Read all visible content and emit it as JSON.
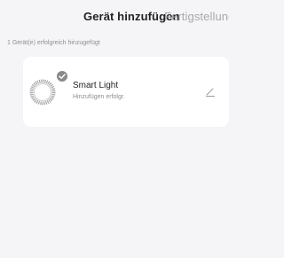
{
  "header": {
    "tabs": [
      {
        "label": "Gerät hinzufügen",
        "active": true
      },
      {
        "label": "Fertigstellung",
        "active": false
      }
    ]
  },
  "status": {
    "message": "1 Gerät(e) erfolgreich hinzugefügt"
  },
  "devices": [
    {
      "name": "Smart Light",
      "status": "Hinzufügen erfolgr.",
      "icon": "smart-light-icon",
      "badge_icon": "check-icon",
      "edit_icon": "pencil-icon"
    }
  ],
  "colors": {
    "background": "#f5f5f7",
    "card": "#ffffff",
    "text_primary": "#222222",
    "text_secondary": "#8e8e93",
    "tab_inactive": "#a8a8ad",
    "badge": "#8a8a8a"
  }
}
